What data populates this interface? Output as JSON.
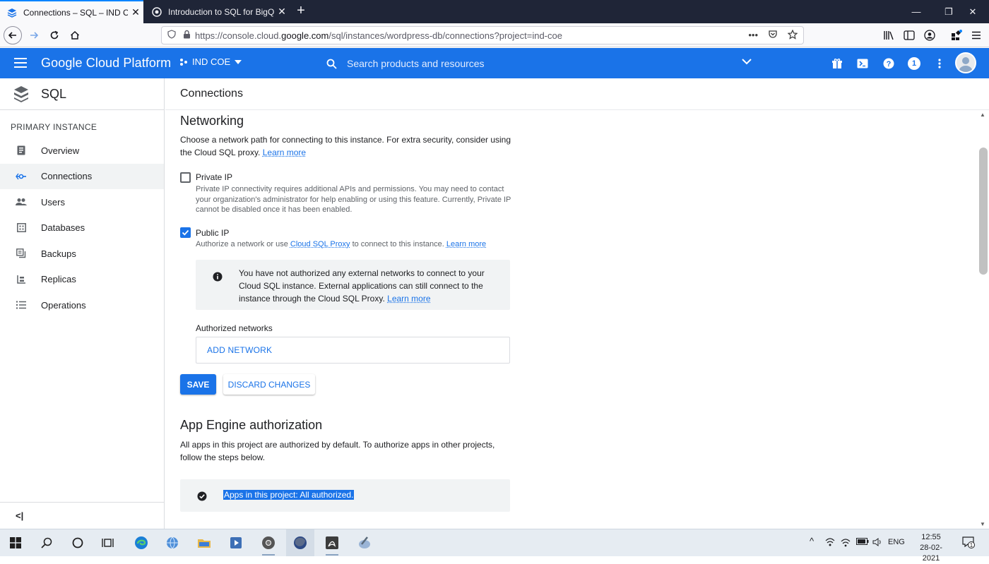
{
  "browser": {
    "tabs": [
      {
        "title": "Connections – SQL – IND COE –",
        "close": "✕"
      },
      {
        "title": "Introduction to SQL for BigQuery",
        "close": "✕"
      }
    ],
    "new_tab": "+",
    "window_controls": {
      "minimize": "—",
      "restore": "❐",
      "close": "✕"
    },
    "url_prefix": "https://console.cloud.",
    "url_domain": "google.com",
    "url_suffix": "/sql/instances/wordpress-db/connections?project=ind-coe",
    "page_actions": "•••"
  },
  "header": {
    "brand": "Google Cloud Platform",
    "project": "IND COE",
    "search_placeholder": "Search products and resources",
    "notification_count": "1"
  },
  "sidebar": {
    "product": "SQL",
    "section": "PRIMARY INSTANCE",
    "items": [
      {
        "label": "Overview",
        "icon": "overview-icon"
      },
      {
        "label": "Connections",
        "icon": "connections-icon",
        "active": true
      },
      {
        "label": "Users",
        "icon": "users-icon"
      },
      {
        "label": "Databases",
        "icon": "databases-icon"
      },
      {
        "label": "Backups",
        "icon": "backups-icon"
      },
      {
        "label": "Replicas",
        "icon": "replicas-icon"
      },
      {
        "label": "Operations",
        "icon": "operations-icon"
      }
    ],
    "collapse": "<|"
  },
  "main": {
    "page_title": "Connections",
    "networking": {
      "title": "Networking",
      "description": "Choose a network path for connecting to this instance. For extra security, consider using the Cloud SQL proxy.",
      "learn_more": "Learn more",
      "private_ip": {
        "label": "Private IP",
        "checked": false,
        "help": "Private IP connectivity requires additional APIs and permissions. You may need to contact your organization's administrator for help enabling or using this feature. Currently, Private IP cannot be disabled once it has been enabled."
      },
      "public_ip": {
        "label": "Public IP",
        "checked": true,
        "help_prefix": "Authorize a network or use",
        "help_link": "Cloud SQL Proxy",
        "help_suffix": "to connect to this instance.",
        "learn_more": "Learn more"
      },
      "info_message": "You have not authorized any external networks to connect to your Cloud SQL instance. External applications can still connect to the instance through the Cloud SQL Proxy.",
      "info_learn_more": "Learn more",
      "authorized_networks_label": "Authorized networks",
      "add_network": "ADD NETWORK",
      "save": "SAVE",
      "discard": "DISCARD CHANGES"
    },
    "app_engine": {
      "title": "App Engine authorization",
      "description": "All apps in this project are authorized by default. To authorize apps in other projects, follow the steps below.",
      "status": "Apps in this project: All authorized."
    }
  },
  "taskbar": {
    "language": "ENG",
    "time": "12:55",
    "date": "28-02-2021",
    "notification_count": "1"
  },
  "colors": {
    "gcp_blue": "#1a73e8",
    "tabbar_dark": "#1f2537"
  }
}
